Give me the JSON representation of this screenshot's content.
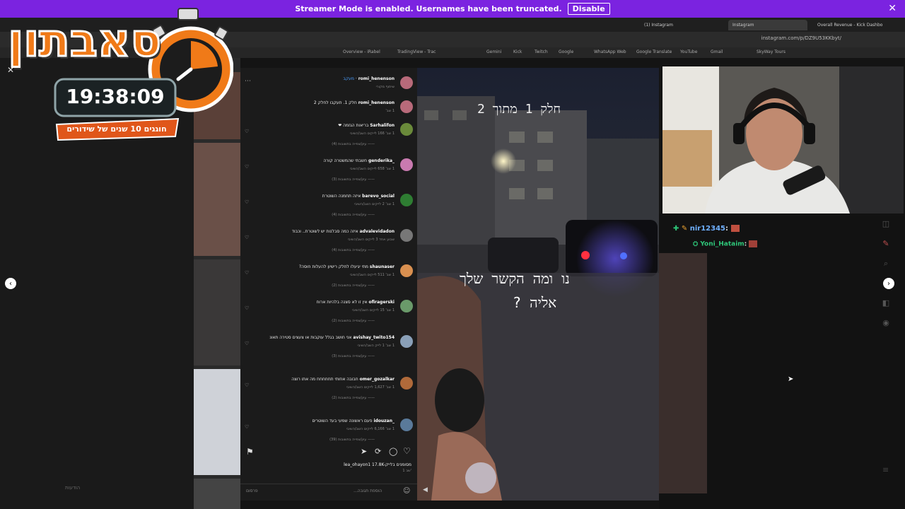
{
  "banner": {
    "text": "Streamer Mode is enabled. Usernames have been truncated.",
    "button": "Disable"
  },
  "tabs": [
    "(1) Instagram",
    "Instagram",
    "Overall Revenue - Kick Dashbo"
  ],
  "url": "instagram.com/p/DZ9U53KKbyt/",
  "bookmarks": [
    "Overview - iRabel",
    "TradingView - Trac",
    "Gemini",
    "Kick",
    "Twitch",
    "Google",
    "WhatsApp Web",
    "Google Translate",
    "YouTube",
    "Gmail",
    "SkyWay Tours"
  ],
  "overlay": {
    "logo_text": "סאבתון",
    "timer": "19:38:09",
    "subtitle": "חוגגים 10 שנים של שידורים"
  },
  "post": {
    "author": "romi_henenson",
    "author_note": "שיתוף מקורי",
    "caption_user": "romi_henenson",
    "caption": "חלק 1. תעקבו לחלק 2",
    "caption_time": "1 שב'",
    "follow_label": "מעקב",
    "likes_text": "lea_ohayon1 17.8K-מסומנים בלייק",
    "time_text": "1 שב'",
    "add_comment": "הוספת תגובה...",
    "post_button": "פרסום"
  },
  "comments": [
    {
      "user": "Sarhalifon",
      "text": "בריאות הגזמה ❤",
      "meta": "1 שב' 166 לייקים השב/השיבי",
      "replies": "—— עיון/צפייה בתשובות (4)",
      "color": "#6a8a3a"
    },
    {
      "user": "_genderika",
      "text": "חשבתי שהמשטרה קורה",
      "meta": "1 שב' 658 לייקים השב/השיבי",
      "replies": "—— עיון/צפייה בתשובות (3)",
      "color": "#c97ab0"
    },
    {
      "user": "barevo_social",
      "text": "איזה תחמנה השוטרת",
      "meta": "1 שב' 2 לייקים השב/השיבי",
      "replies": "—— עיון/צפייה בתשובות (4)",
      "color": "#2e7d32"
    },
    {
      "user": "advalevidadon",
      "text": "איזה כמה סבלנות יש לשוטרת.. וכבוד",
      "meta": "שבוע אחד 3 לייקים השב/השיבי",
      "replies": "—— עיון/צפייה בתשובות (4)",
      "color": "#777777"
    },
    {
      "user": "shaunaser",
      "text": "מתי יגיעלו לחלק רישיון להעלות חוסה?",
      "meta": "1 שב' 511 לייקים השב/השיבי",
      "replies": "—— עיון/צפייה בתשובות (2)",
      "color": "#d99050"
    },
    {
      "user": "ofiragerski",
      "text": "אין זו לא סצנה בלהיות ארוח",
      "meta": "1 שב' 15 לייקים השב/השיבי",
      "replies": "—— עיון/צפייה בתשובות (2)",
      "color": "#6a9a6a"
    },
    {
      "user": "avishay_twito154",
      "text": "אני חושב בגלל עוקבות או צעצים סטירה תאונ",
      "meta": "1 שב' 1 לייק השב/השיבי",
      "replies": "—— עיון/צפייה בתשובות (3)",
      "color": "#8aa0b8"
    },
    {
      "user": "omer_gozalkar",
      "text": "חבובה אחותי תחחחחח מה אתו רוצה",
      "meta": "1 שב' 1,627 לייקים השב/השיבי",
      "replies": "—— עיון/צפייה בתשובות (2)",
      "color": "#b06a3a"
    },
    {
      "user": "_idouzan",
      "text": "פעם ראשונה שמעי בעד השוטרים",
      "meta": "1 שב' 6,166 לייקים השב/השיבי",
      "replies": "—— עיון/צפייה בתשובות (39)",
      "color": "#5a7a9a"
    }
  ],
  "video": {
    "top_caption": "חלק 1 מתוך 2",
    "mid_caption_1": "נו ומה הקשר שלך",
    "mid_caption_2": "אליה ?"
  },
  "chat": [
    {
      "user": "nir12345",
      "color": "#6fb0ff"
    },
    {
      "user": "Yoni_Hataim",
      "color": "#2ec87a"
    }
  ],
  "sidebar_label": "הודעות"
}
